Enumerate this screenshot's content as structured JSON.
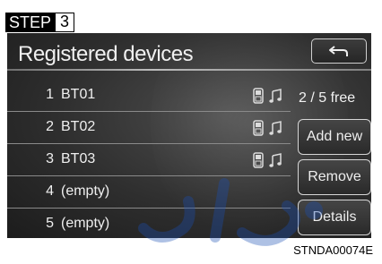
{
  "step": {
    "word": "STEP",
    "number": "3"
  },
  "screen": {
    "title": "Registered devices",
    "back_icon": "back-arrow-icon",
    "free_text": "2 / 5 free",
    "devices": [
      {
        "index": "1",
        "name": "BT01",
        "phone": true,
        "audio": true
      },
      {
        "index": "2",
        "name": "BT02",
        "phone": true,
        "audio": true
      },
      {
        "index": "3",
        "name": "BT03",
        "phone": true,
        "audio": true
      },
      {
        "index": "4",
        "name": "(empty)",
        "phone": false,
        "audio": false
      },
      {
        "index": "5",
        "name": "(empty)",
        "phone": false,
        "audio": false
      }
    ],
    "buttons": {
      "add_new": "Add new",
      "remove": "Remove",
      "details": "Details"
    }
  },
  "figure_code": "STNDA00074E",
  "colors": {
    "screen_bg": "#2e2e2e",
    "text": "#efefef",
    "watermark": "#1a4fb5"
  }
}
